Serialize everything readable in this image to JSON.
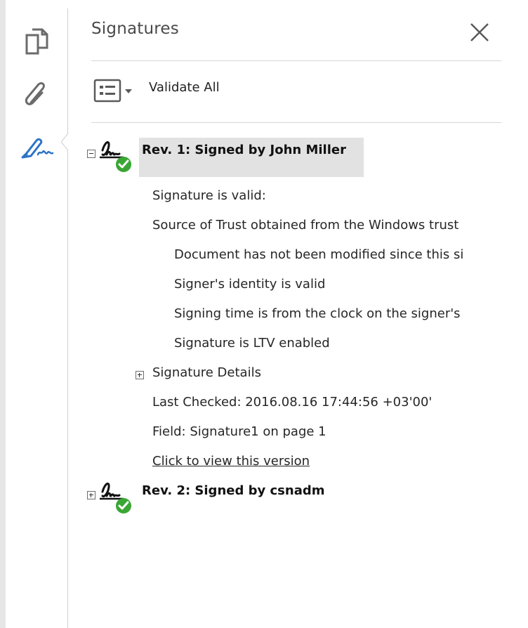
{
  "panel": {
    "title": "Signatures",
    "validate_all_label": "Validate All"
  },
  "left_rail": {
    "icons": [
      "pages-icon",
      "attachments-icon",
      "signature-pen-icon"
    ],
    "active": "signature-pen-icon",
    "active_color": "#2b74c7"
  },
  "revisions": [
    {
      "title": "Rev. 1: Signed by John Miller",
      "expanded": true,
      "status": "valid",
      "status_color": "#3aa634",
      "details": {
        "summary": "Signature is valid:",
        "trust_source": "Source of Trust obtained from the Windows trust",
        "checks": [
          "Document has not been modified since this si",
          "Signer's identity is valid",
          "Signing time is from the clock on the signer's",
          "Signature is LTV enabled"
        ],
        "signature_details_label": "Signature Details",
        "last_checked": "Last Checked: 2016.08.16 17:44:56 +03'00'",
        "field": "Field: Signature1 on page 1",
        "view_version_link": "Click to view this version"
      }
    },
    {
      "title": "Rev. 2: Signed by csnadm",
      "expanded": false,
      "status": "valid",
      "status_color": "#3aa634"
    }
  ]
}
